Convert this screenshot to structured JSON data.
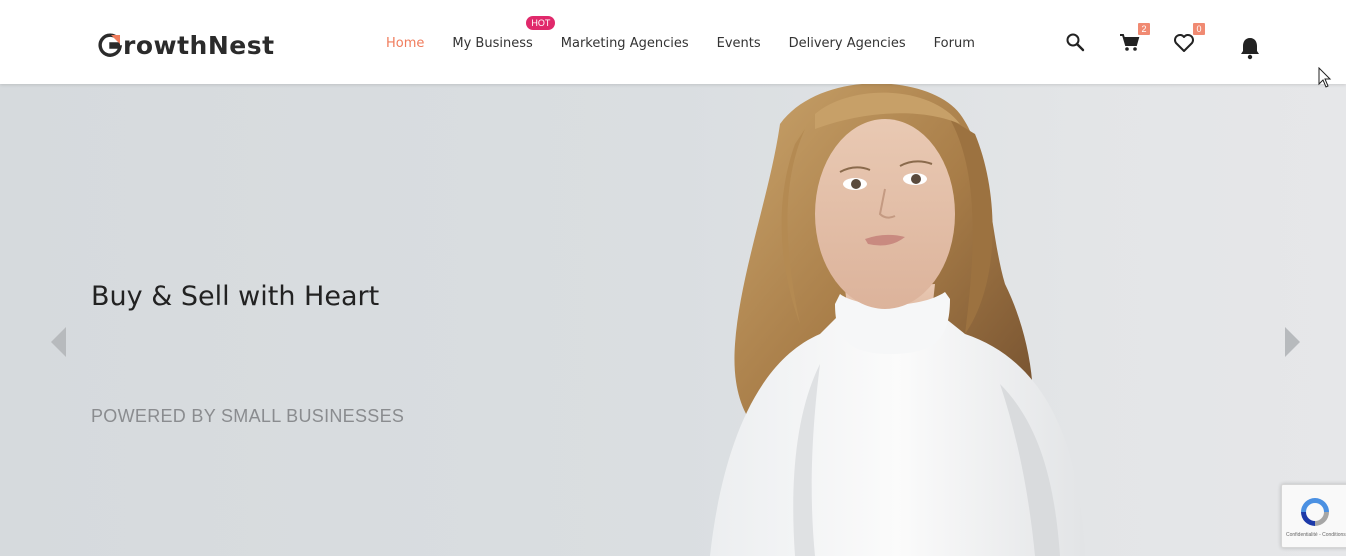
{
  "brand": {
    "name": "rowthNest",
    "logo_letter": "G"
  },
  "nav": {
    "items": [
      {
        "label": "Home",
        "active": true
      },
      {
        "label": "My Business",
        "badge": "HOT"
      },
      {
        "label": "Marketing Agencies"
      },
      {
        "label": "Events"
      },
      {
        "label": "Delivery Agencies"
      },
      {
        "label": "Forum"
      }
    ]
  },
  "header_icons": {
    "search": "search-icon",
    "cart": {
      "icon": "cart-icon",
      "count": "2"
    },
    "wishlist": {
      "icon": "heart-icon",
      "count": "0"
    },
    "notifications": "bell-icon"
  },
  "hero": {
    "title": "Buy & Sell with Heart",
    "subtitle": "POWERED BY SMALL BUSINESSES",
    "prev": "previous-slide",
    "next": "next-slide"
  },
  "recaptcha": {
    "footer": "Confidentialité - Conditions"
  },
  "colors": {
    "accent": "#f07c5c",
    "hot_badge": "#e0296b",
    "count_badge": "#f08a72",
    "hero_bg": "#d9dde0"
  }
}
